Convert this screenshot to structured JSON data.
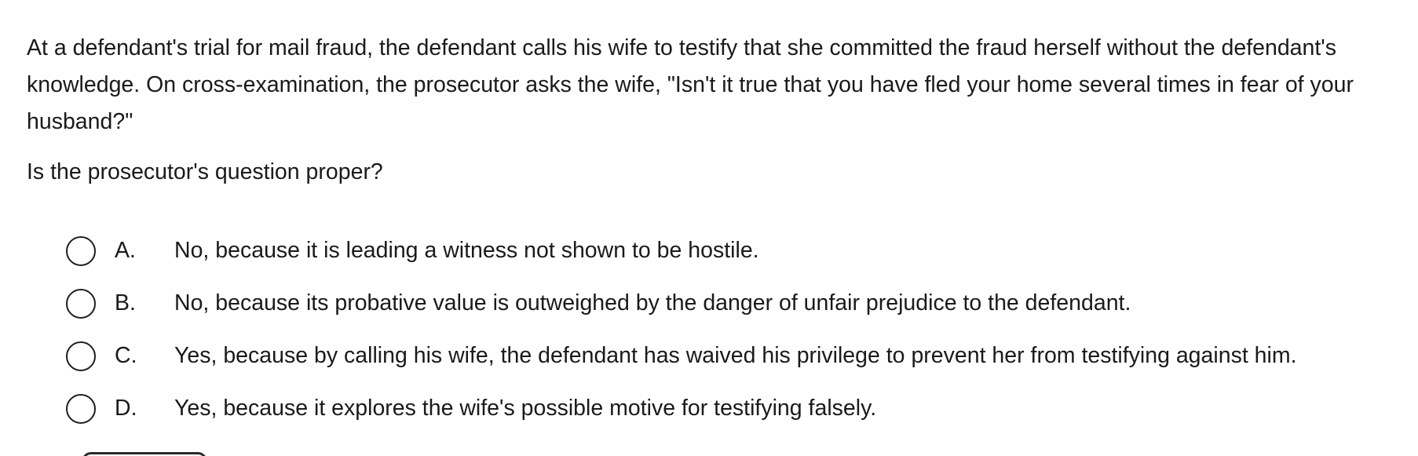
{
  "question": {
    "stem": "At a defendant's trial for mail fraud, the defendant calls his wife to testify that she committed the fraud herself without the defendant's knowledge.  On cross-examination, the prosecutor asks the wife, \"Isn't it true that you have fled your home several times in fear of your husband?\"",
    "prompt": "Is the prosecutor's question proper?"
  },
  "choices": [
    {
      "letter": "A.",
      "text": "No, because it is leading a witness not shown to be hostile.",
      "selected": false
    },
    {
      "letter": "B.",
      "text": "No, because its probative value is outweighed by the danger of unfair prejudice to the defendant.",
      "selected": false
    },
    {
      "letter": "C.",
      "text": "Yes, because by calling his wife, the defendant has waived his privilege to prevent her from testifying against him.",
      "selected": false
    },
    {
      "letter": "D.",
      "text": "Yes, because it explores the wife's possible motive for testifying falsely.",
      "selected": false
    }
  ]
}
